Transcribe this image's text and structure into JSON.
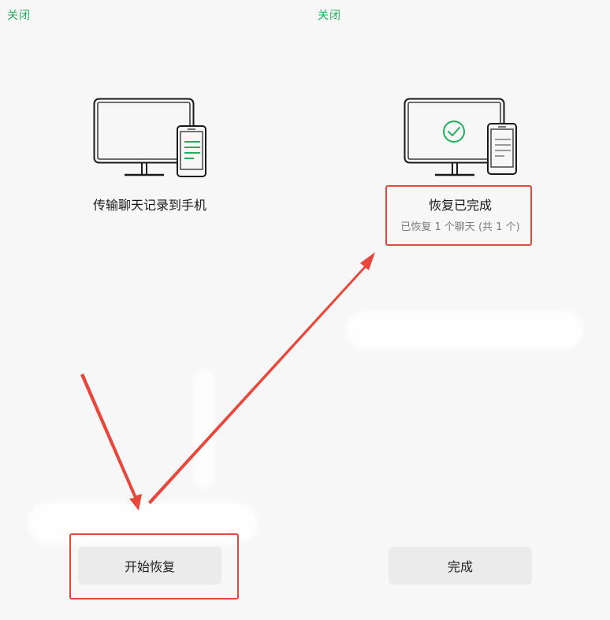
{
  "left_panel": {
    "close_label": "关闭",
    "title": "传输聊天记录到手机",
    "button_label": "开始恢复"
  },
  "right_panel": {
    "close_label": "关闭",
    "title": "恢复已完成",
    "subtitle": "已恢复 1 个聊天 (共 1 个)",
    "button_label": "完成"
  },
  "icons": {
    "left_illustration": "computer-phone-transfer-icon",
    "right_illustration": "computer-phone-check-icon"
  },
  "colors": {
    "accent_green": "#20b05b",
    "annotation_red": "#e8473b",
    "button_bg": "#ebebeb"
  }
}
